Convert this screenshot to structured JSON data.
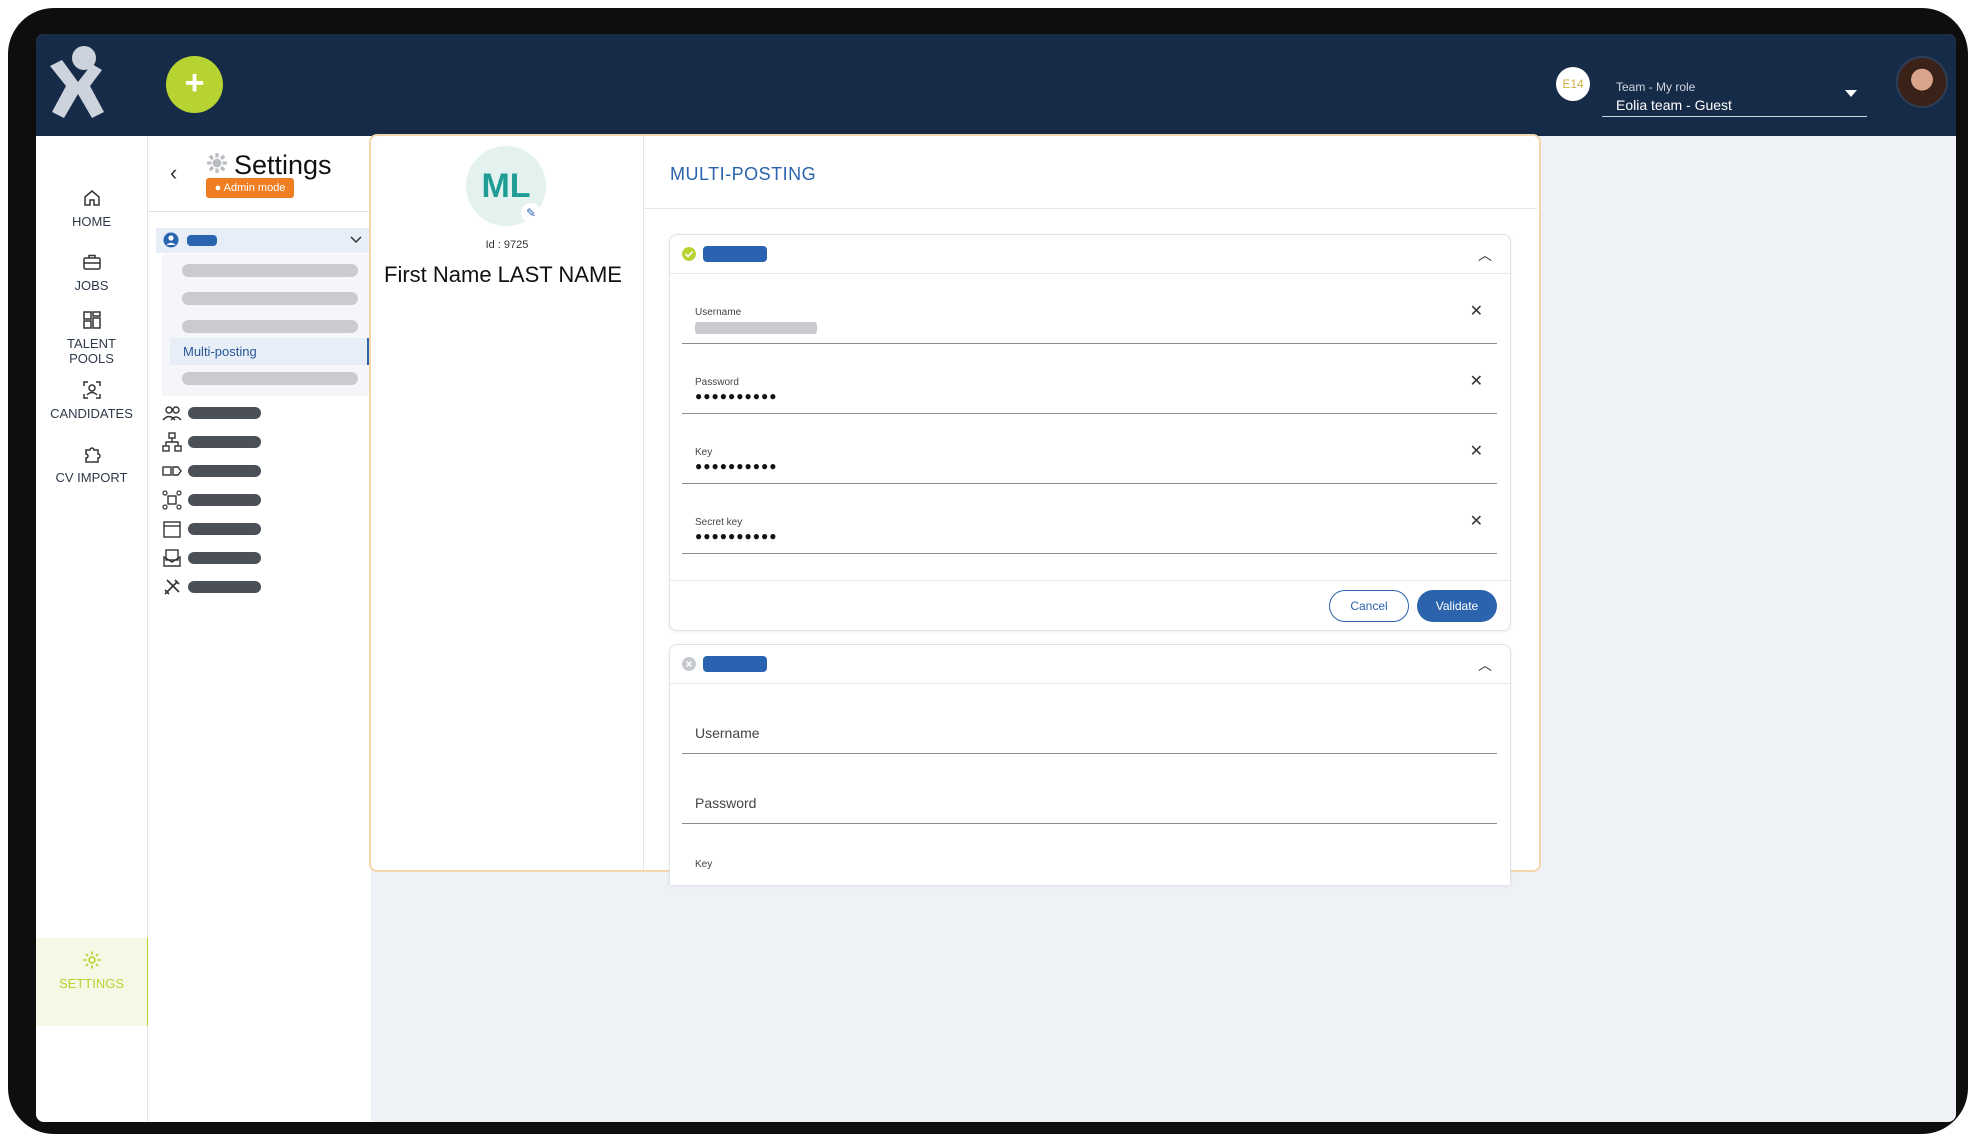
{
  "topbar": {
    "team_badge": "E14",
    "role_label": "Team - My role",
    "role_value": "Eolia team - Guest"
  },
  "nav": {
    "home": "HOME",
    "jobs": "JOBS",
    "talent_pools": "TALENT POOLS",
    "candidates": "CANDIDATES",
    "cv_import": "CV IMPORT",
    "settings": "SETTINGS"
  },
  "settings_panel": {
    "title": "Settings",
    "admin_chip": "Admin mode",
    "active_item": "Multi-posting"
  },
  "profile": {
    "initials": "ML",
    "id_label": "Id : 9725",
    "name": "First Name LAST NAME"
  },
  "multiposting": {
    "title": "MULTI-POSTING",
    "panel1": {
      "status": "active",
      "fields": [
        {
          "label": "Username"
        },
        {
          "label": "Password",
          "value": "●●●●●●●●●●"
        },
        {
          "label": "Key",
          "value": "●●●●●●●●●●"
        },
        {
          "label": "Secret key",
          "value": "●●●●●●●●●●"
        }
      ],
      "cancel": "Cancel",
      "validate": "Validate"
    },
    "panel2": {
      "status": "inactive",
      "fields": [
        {
          "label": "Username"
        },
        {
          "label": "Password"
        },
        {
          "label": "Key"
        }
      ]
    }
  },
  "colors": {
    "topbar": "#162b48",
    "accent_green": "#b7d332",
    "primary_blue": "#2b63ad",
    "admin_orange": "#ef7d22"
  }
}
